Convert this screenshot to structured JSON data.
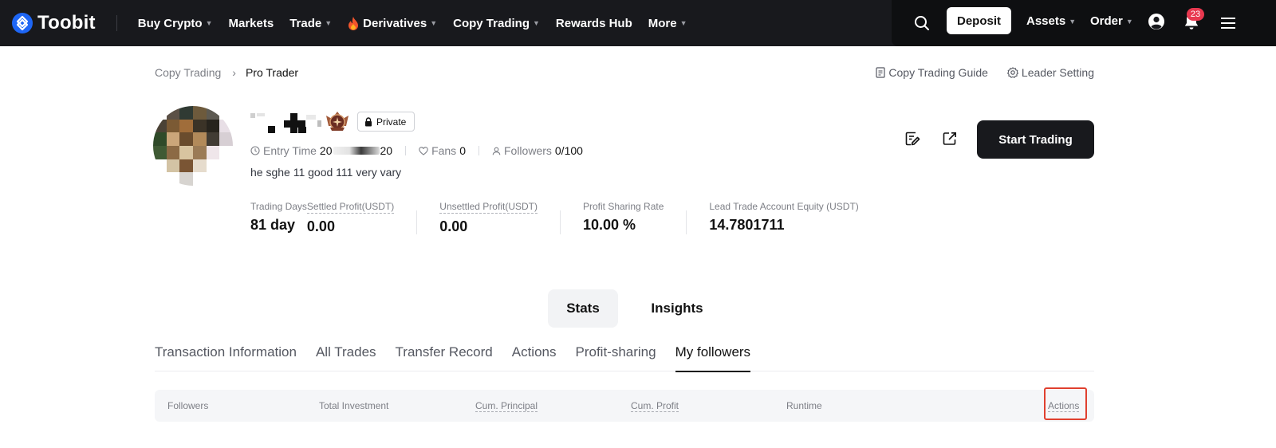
{
  "topnav": {
    "brand": "Toobit",
    "menu": [
      {
        "label": "Buy Crypto",
        "has_caret": true
      },
      {
        "label": "Markets",
        "has_caret": false
      },
      {
        "label": "Trade",
        "has_caret": true
      },
      {
        "label": "Derivatives",
        "has_caret": true,
        "icon": "fire-icon"
      },
      {
        "label": "Copy Trading",
        "has_caret": true
      },
      {
        "label": "Rewards Hub",
        "has_caret": false
      },
      {
        "label": "More",
        "has_caret": true
      }
    ],
    "deposit_label": "Deposit",
    "assets_label": "Assets",
    "order_label": "Order",
    "notification_count": "23",
    "accent_color": "#1e66f5"
  },
  "breadcrumb": {
    "parent": "Copy Trading",
    "current": "Pro Trader"
  },
  "top_links": {
    "guide": "Copy Trading Guide",
    "leader_setting": "Leader Setting"
  },
  "profile": {
    "private_label": "Private",
    "entry_time_label": "Entry Time",
    "entry_time_prefix": "20",
    "entry_time_suffix": "20",
    "fans_label": "Fans",
    "fans_value": "0",
    "followers_label": "Followers",
    "followers_value": "0/100",
    "bio": "he sghe 11 good 111 very vary"
  },
  "stats": [
    {
      "label": "Trading Days",
      "value": "81 day",
      "dotted": false
    },
    {
      "label": "Settled Profit(USDT)",
      "value": "0.00",
      "dotted": true
    },
    {
      "label": "Unsettled Profit(USDT)",
      "value": "0.00",
      "dotted": true
    },
    {
      "label": "Profit Sharing Rate",
      "value": "10.00 %",
      "dotted": false
    },
    {
      "label": "Lead Trade Account Equity (USDT)",
      "value": "14.7801711",
      "dotted": false
    }
  ],
  "start_trading_label": "Start Trading",
  "segment": {
    "stats": "Stats",
    "insights": "Insights"
  },
  "subtabs": [
    "Transaction Information",
    "All Trades",
    "Transfer Record",
    "Actions",
    "Profit-sharing",
    "My followers"
  ],
  "active_subtab": "My followers",
  "table": {
    "columns": [
      {
        "label": "Followers",
        "dotted": false
      },
      {
        "label": "Total Investment",
        "dotted": false
      },
      {
        "label": "Cum. Principal",
        "dotted": true
      },
      {
        "label": "Cum. Profit",
        "dotted": true
      },
      {
        "label": "Runtime",
        "dotted": false
      },
      {
        "label": "Actions",
        "dotted": true
      }
    ]
  },
  "highlight_color": "#e0402f"
}
